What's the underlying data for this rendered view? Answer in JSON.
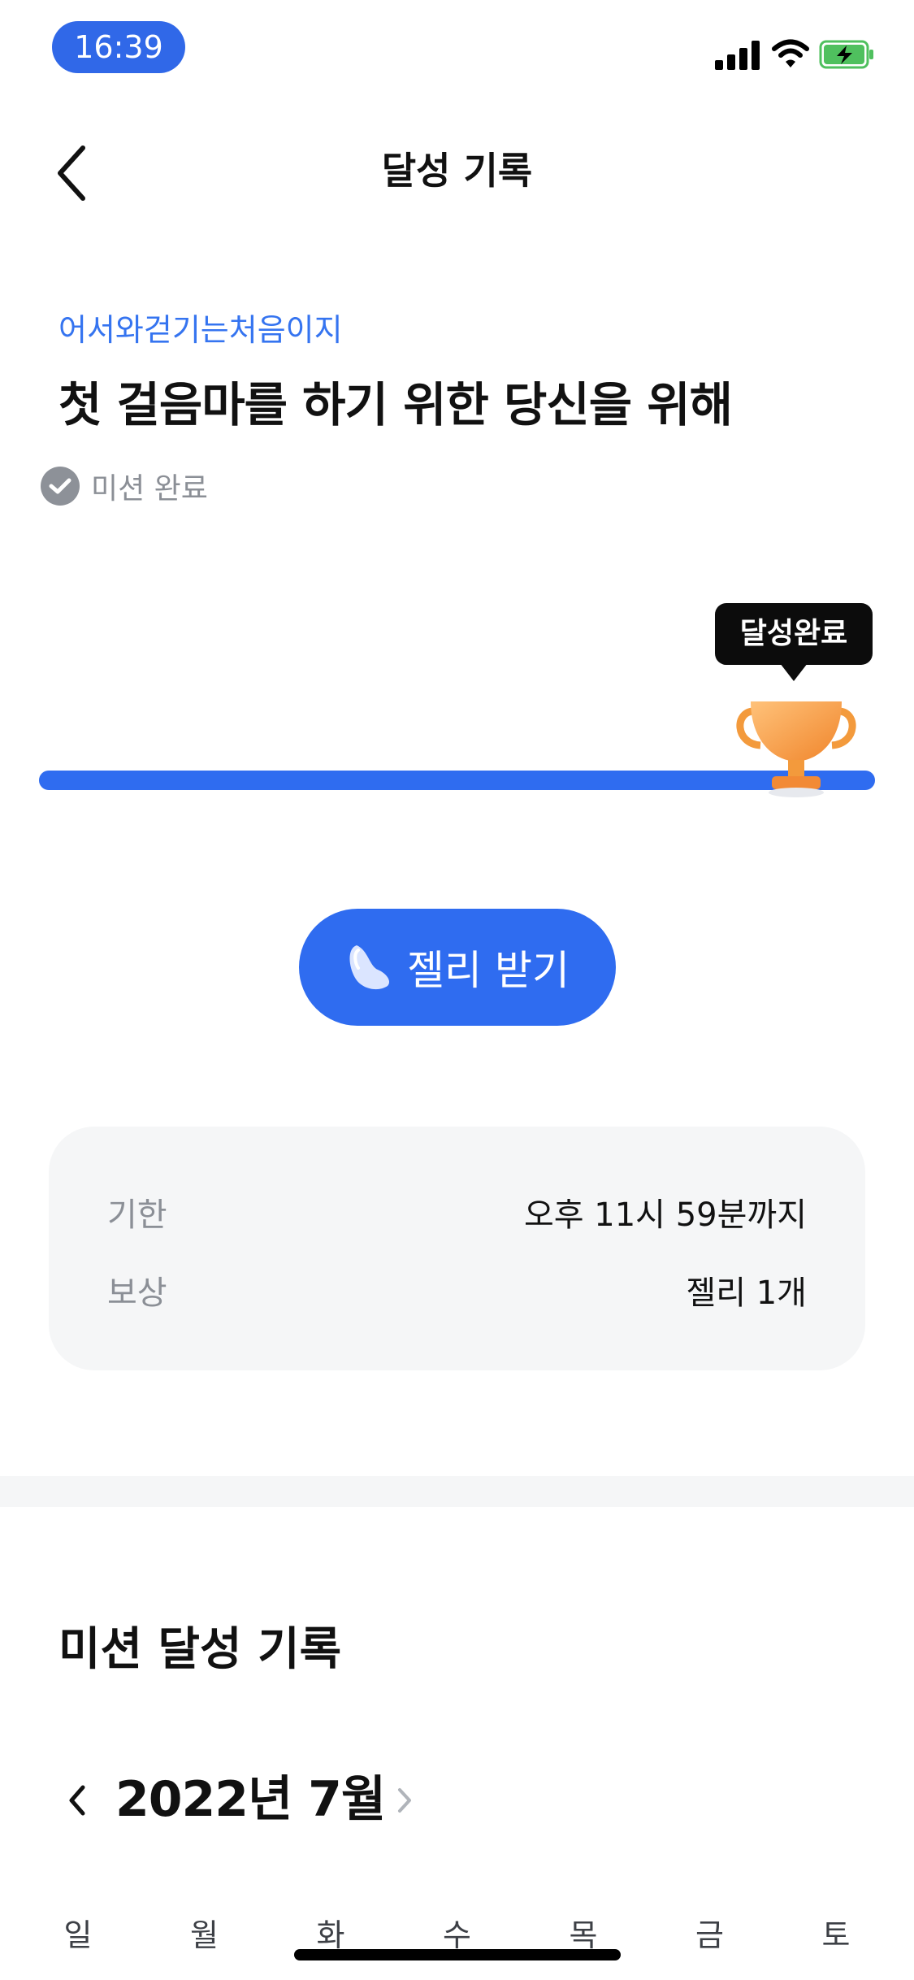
{
  "status_bar": {
    "time": "16:39"
  },
  "header": {
    "title": "달성 기록"
  },
  "mission": {
    "subtitle": "어서와걷기는처음이지",
    "title": "첫 걸음마를 하기 위한 당신을 위해",
    "status": "미션 완료"
  },
  "progress": {
    "value_percent": 100,
    "tooltip": "달성완료"
  },
  "reward_button": {
    "label": "젤리 받기"
  },
  "info": [
    {
      "label": "기한",
      "value": "오후 11시 59분까지"
    },
    {
      "label": "보상",
      "value": "젤리 1개"
    }
  ],
  "history": {
    "title": "미션 달성 기록",
    "month": "2022년 7월",
    "weekdays": [
      "일",
      "월",
      "화",
      "수",
      "목",
      "금",
      "토"
    ]
  },
  "colors": {
    "accent": "#2f6cf0",
    "subtitle": "#3574f0",
    "card": "#f5f6f7",
    "muted": "#8b8f96"
  }
}
